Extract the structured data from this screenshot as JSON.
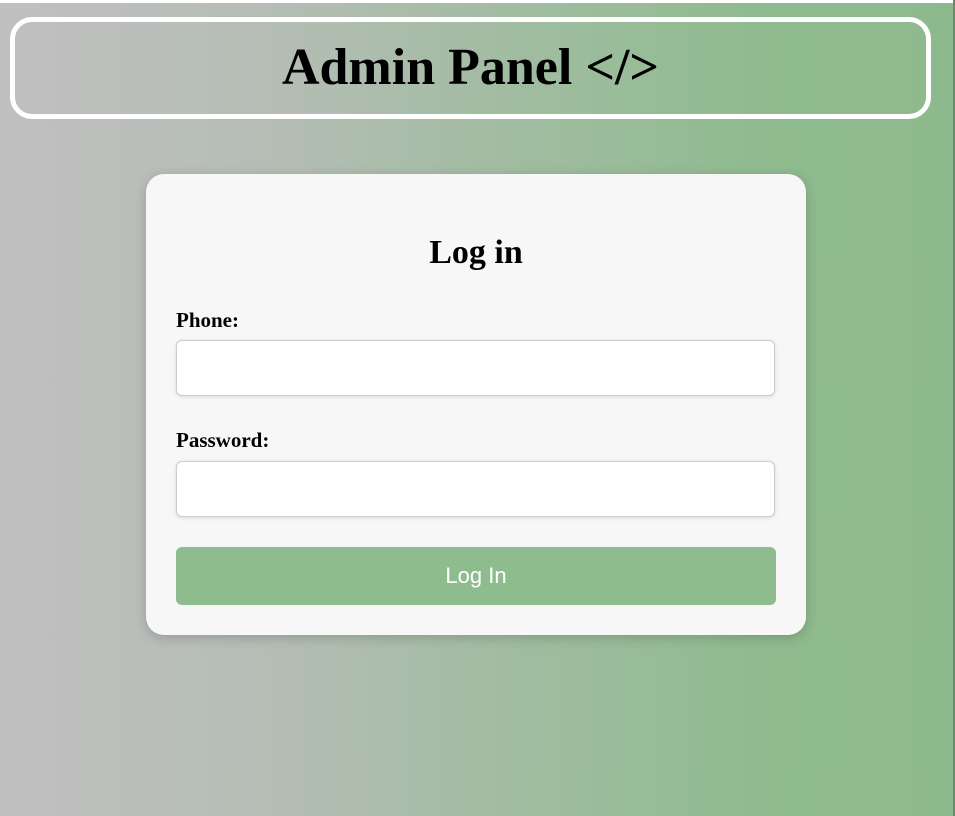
{
  "header": {
    "title": "Admin Panel </>"
  },
  "login_form": {
    "title": "Log in",
    "phone_label": "Phone:",
    "phone_value": "",
    "password_label": "Password:",
    "password_value": "",
    "submit_label": "Log In"
  },
  "colors": {
    "accent": "#8fbc8f",
    "card_background": "#f7f7f7",
    "gradient_start": "#c0bfc0",
    "gradient_end": "#8dba8d"
  }
}
